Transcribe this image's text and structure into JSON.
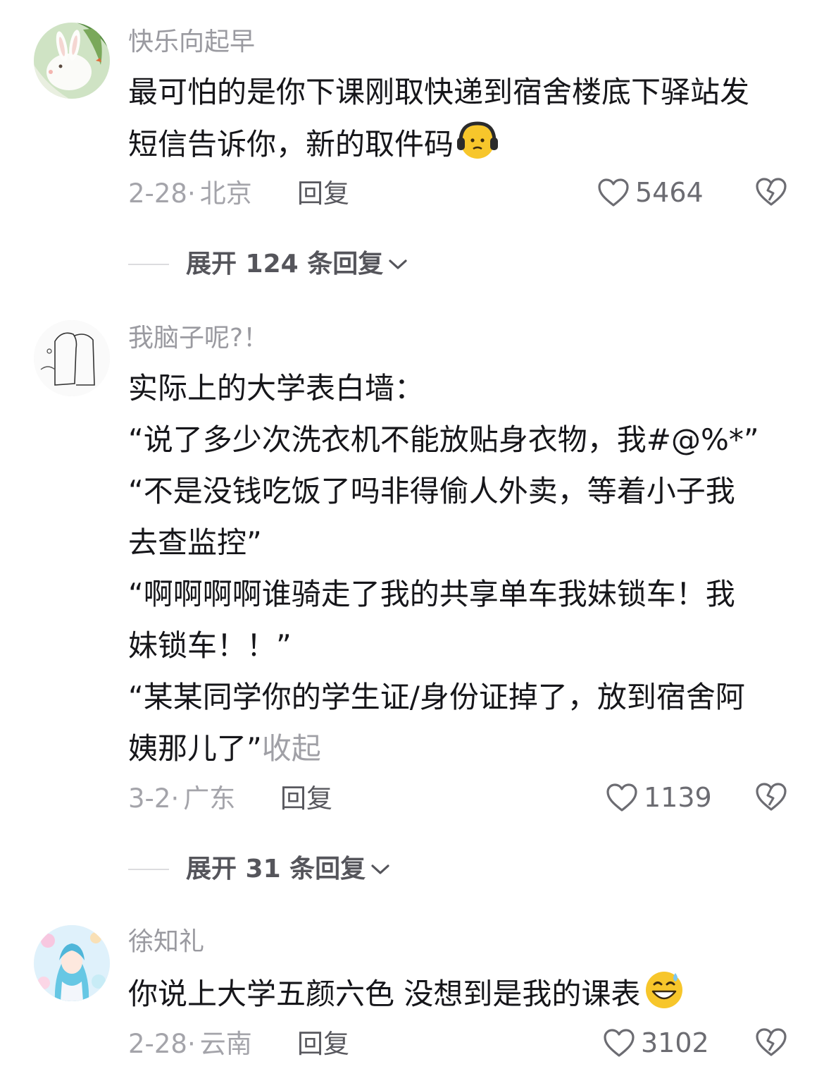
{
  "comments": [
    {
      "username": "快乐向起早",
      "lines": [
        "最可怕的是你下课刚取快递到宿舍楼底下驿站发",
        "短信告诉你，新的取件码"
      ],
      "emoji": "headphones-face-emoji",
      "date": "2-28",
      "sep": "·",
      "location": "北京",
      "reply_label": "回复",
      "like_count": "5464",
      "expand_label": "展开 124 条回复"
    },
    {
      "username": "我脑子呢?！",
      "lines": [
        "实际上的大学表白墙：",
        "“说了多少次洗衣机不能放贴身衣物，我#@%*”",
        "“不是没钱吃饭了吗非得偷人外卖，等着小子我",
        "去查监控”",
        "“啊啊啊啊谁骑走了我的共享单车我妹锁车！我",
        "妹锁车！！”",
        "“某某同学你的学生证/身份证掉了，放到宿舍阿",
        "姨那儿了”"
      ],
      "collapse_label": "收起",
      "date": "3-2",
      "sep": "·",
      "location": "广东",
      "reply_label": "回复",
      "like_count": "1139",
      "expand_label": "展开 31 条回复"
    },
    {
      "username": "徐知礼",
      "lines": [
        "你说上大学五颜六色 没想到是我的课表"
      ],
      "emoji": "grinning-sweat-emoji",
      "date": "2-28",
      "sep": "·",
      "location": "云南",
      "reply_label": "回复",
      "like_count": "3102"
    }
  ],
  "colors": {
    "username": "#9a9aa0",
    "content": "#16161a",
    "meta": "#a4a4aa",
    "accent_emoji": "#f7c62b"
  }
}
